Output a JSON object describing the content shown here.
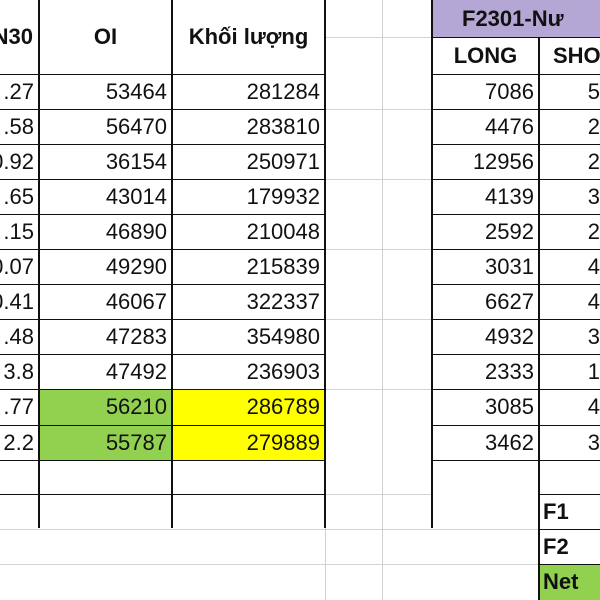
{
  "left_table": {
    "headers": {
      "col_a": "N30",
      "col_b": "OI",
      "col_c": "Khối lượng"
    },
    "rows": [
      {
        "a": ".27",
        "b": "53464",
        "c": "281284"
      },
      {
        "a": ".58",
        "b": "56470",
        "c": "283810"
      },
      {
        "a": "0.92",
        "b": "36154",
        "c": "250971"
      },
      {
        "a": ".65",
        "b": "43014",
        "c": "179932"
      },
      {
        "a": ".15",
        "b": "46890",
        "c": "210048"
      },
      {
        "a": "0.07",
        "b": "49290",
        "c": "215839"
      },
      {
        "a": "0.41",
        "b": "46067",
        "c": "322337"
      },
      {
        "a": ".48",
        "b": "47283",
        "c": "354980"
      },
      {
        "a": "3.8",
        "b": "47492",
        "c": "236903"
      },
      {
        "a": ".77",
        "b": "56210",
        "c": "286789"
      },
      {
        "a": "2.2",
        "b": "55787",
        "c": "279889"
      }
    ]
  },
  "right_table": {
    "title": "F2301-Nư",
    "headers": {
      "long": "LONG",
      "short": "SHO"
    },
    "rows": [
      {
        "long": "7086",
        "short": "5"
      },
      {
        "long": "4476",
        "short": "2"
      },
      {
        "long": "12956",
        "short": "2"
      },
      {
        "long": "4139",
        "short": "3"
      },
      {
        "long": "2592",
        "short": "2"
      },
      {
        "long": "3031",
        "short": "4"
      },
      {
        "long": "6627",
        "short": "4"
      },
      {
        "long": "4932",
        "short": "3"
      },
      {
        "long": "2333",
        "short": "1"
      },
      {
        "long": "3085",
        "short": "4"
      },
      {
        "long": "3462",
        "short": "3"
      }
    ],
    "summary_labels": [
      "F1",
      "F2",
      "Net"
    ]
  },
  "colors": {
    "green_fill": "#92d050",
    "yellow_fill": "#ffff00",
    "purple_header": "#b4a7d6",
    "gridline": "#d4d4d4",
    "border": "#111111"
  }
}
